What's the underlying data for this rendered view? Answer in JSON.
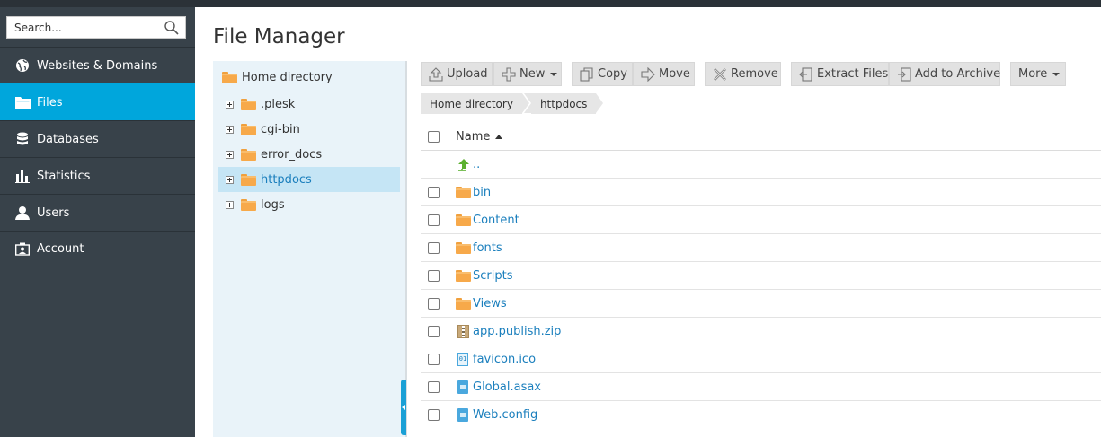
{
  "search": {
    "placeholder": "Search..."
  },
  "nav": [
    {
      "label": "Websites & Domains",
      "icon": "globe-icon",
      "active": false
    },
    {
      "label": "Files",
      "icon": "folder-icon",
      "active": true
    },
    {
      "label": "Databases",
      "icon": "database-icon",
      "active": false
    },
    {
      "label": "Statistics",
      "icon": "bar-chart-icon",
      "active": false
    },
    {
      "label": "Users",
      "icon": "user-icon",
      "active": false
    },
    {
      "label": "Account",
      "icon": "account-card-icon",
      "active": false
    }
  ],
  "page": {
    "title": "File Manager"
  },
  "tree": {
    "root": "Home directory",
    "items": [
      ".plesk",
      "cgi-bin",
      "error_docs",
      "httpdocs",
      "logs"
    ],
    "selected": "httpdocs"
  },
  "toolbar": {
    "upload": "Upload",
    "new": "New",
    "copy": "Copy",
    "move": "Move",
    "remove": "Remove",
    "extract": "Extract Files",
    "archive": "Add to Archive",
    "more": "More"
  },
  "breadcrumb": [
    "Home directory",
    "httpdocs"
  ],
  "list": {
    "name_header": "Name",
    "sort": "ascending",
    "parent": "..",
    "rows": [
      {
        "name": "bin",
        "type": "folder"
      },
      {
        "name": "Content",
        "type": "folder"
      },
      {
        "name": "fonts",
        "type": "folder"
      },
      {
        "name": "Scripts",
        "type": "folder"
      },
      {
        "name": "Views",
        "type": "folder"
      },
      {
        "name": "app.publish.zip",
        "type": "zip"
      },
      {
        "name": "favicon.ico",
        "type": "binary"
      },
      {
        "name": "Global.asax",
        "type": "document"
      },
      {
        "name": "Web.config",
        "type": "document"
      }
    ]
  },
  "colors": {
    "accent": "#00a6dc",
    "sidebar": "#38424a",
    "tree_bg": "#e9f3f9",
    "link": "#1b7fbd",
    "folder": "#f7a94a"
  }
}
